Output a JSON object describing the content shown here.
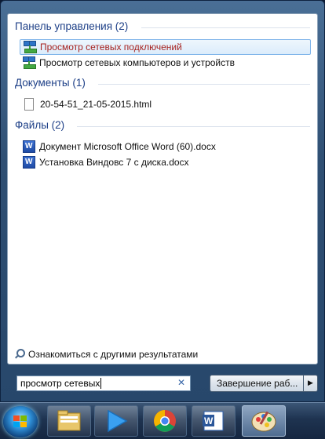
{
  "groups": {
    "control_panel": {
      "header": "Панель управления (2)",
      "items": [
        {
          "label": "Просмотр сетевых подключений",
          "icon": "network-icon"
        },
        {
          "label": "Просмотр сетевых компьютеров и устройств",
          "icon": "network-icon"
        }
      ]
    },
    "documents": {
      "header": "Документы (1)",
      "items": [
        {
          "label": "20-54-51_21-05-2015.html",
          "icon": "document-icon"
        }
      ]
    },
    "files": {
      "header": "Файлы (2)",
      "items": [
        {
          "label": "Документ Microsoft Office Word (60).docx",
          "icon": "word-doc-icon"
        },
        {
          "label": "Установка Виндовс 7 с диска.docx",
          "icon": "word-doc-icon"
        }
      ]
    }
  },
  "more_results": "Ознакомиться с другими результатами",
  "search": {
    "value": "просмотр сетевых"
  },
  "shutdown": {
    "label": "Завершение раб..."
  },
  "taskbar": {
    "items": [
      {
        "name": "explorer",
        "icon": "folder-icon"
      },
      {
        "name": "media-player",
        "icon": "play-icon"
      },
      {
        "name": "chrome",
        "icon": "chrome-icon"
      },
      {
        "name": "word",
        "icon": "word-icon"
      },
      {
        "name": "paint",
        "icon": "paint-icon"
      }
    ]
  },
  "colors": {
    "group_header": "#1d3f87",
    "selected_text": "#a6221f",
    "selected_border": "#7eb4ea"
  }
}
